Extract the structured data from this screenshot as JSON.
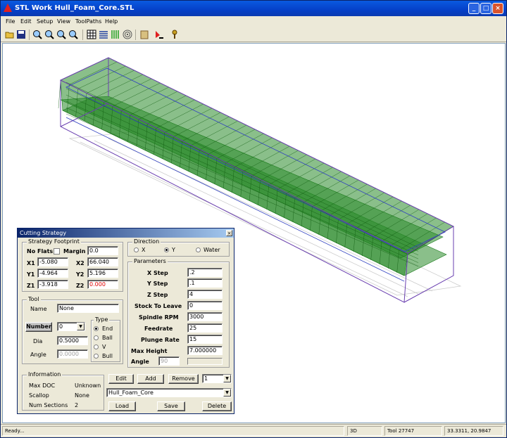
{
  "window": {
    "title": "STL Work   Hull_Foam_Core.STL",
    "min": "_",
    "max": "□",
    "close": "×"
  },
  "menu": [
    "File",
    "Edit",
    "Setup",
    "View",
    "ToolPaths",
    "Help"
  ],
  "toolbar": [
    "open-icon",
    "save-icon",
    "zoom-fit-icon",
    "zoom-window-icon",
    "zoom-in-icon",
    "zoom-out-icon",
    "grid-icon",
    "list-lines-icon",
    "vertical-lines-icon",
    "spiral-icon",
    "stock-icon",
    "cut-icon",
    "tool-wrench-icon"
  ],
  "dialog": {
    "title": "Cutting Strategy",
    "footprint": {
      "label": "Strategy Footprint",
      "no_flats": "No Flats",
      "margin_label": "Margin",
      "margin": "0.0",
      "x1_label": "X1",
      "x1": "-5.080",
      "x2_label": "X2",
      "x2": "66.040",
      "y1_label": "Y1",
      "y1": "-4.964",
      "y2_label": "Y2",
      "y2": "5.196",
      "z1_label": "Z1",
      "z1": "-3.918",
      "z2_label": "Z2",
      "z2": "0.000"
    },
    "direction": {
      "label": "Direction",
      "x": "X",
      "y": "Y",
      "water": "Water",
      "selected": "Y"
    },
    "parameters": {
      "label": "Parameters",
      "x_step_label": "X Step",
      "x_step": ".2",
      "y_step_label": "Y Step",
      "y_step": ".1",
      "z_step_label": "Z Step",
      "z_step": "4",
      "stock_label": "Stock To Leave",
      "stock": "0",
      "rpm_label": "Spindle RPM",
      "rpm": "3000",
      "feed_label": "Feedrate",
      "feed": "25",
      "plunge_label": "Plunge Rate",
      "plunge": "15",
      "maxh_label": "Max Height",
      "maxh": "7.000000",
      "angle_label": "Angle",
      "angle": "90"
    },
    "tool": {
      "label": "Tool",
      "name_label": "Name",
      "name": "None",
      "number_label": "Number",
      "number": "0",
      "dia_label": "Dia",
      "dia": "0.5000",
      "angle_label": "Angle",
      "angle": "0.0000",
      "type_label": "Type",
      "types": [
        "End",
        "Ball",
        "V",
        "Bull"
      ],
      "selected": "End"
    },
    "info": {
      "label": "Information",
      "max_doc_label": "Max DOC",
      "max_doc": "Unknown",
      "scallop_label": "Scallop",
      "scallop": "None",
      "sections_label": "Num Sections",
      "sections": "2"
    },
    "buttons": {
      "edit": "Edit",
      "add": "Add",
      "remove": "Remove",
      "load": "Load",
      "save": "Save",
      "delete": "Delete"
    },
    "strategy_number": "1",
    "strategy_name": "Hull_Foam_Core"
  },
  "status": {
    "ready": "Ready...",
    "mode": "3D",
    "tool": "Tool 27747",
    "coords": "33.3311, 20.9847"
  },
  "colors": {
    "mesh": "#1a7a1a",
    "bbox": "#6a3fb0",
    "titlebar": "#0a5ae0"
  }
}
